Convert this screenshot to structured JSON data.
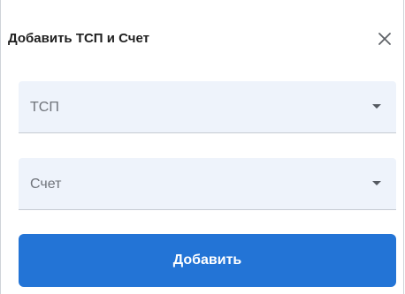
{
  "dialog": {
    "title": "Добавить ТСП и Счет",
    "close_icon": "close-icon"
  },
  "fields": {
    "tsp": {
      "label": "ТСП",
      "icon": "dropdown-arrow-icon"
    },
    "account": {
      "label": "Счет",
      "icon": "dropdown-arrow-icon"
    }
  },
  "actions": {
    "add_label": "Добавить"
  },
  "colors": {
    "primary": "#2374d6",
    "field_background": "#eef3fb",
    "title_text": "#1f1f1f",
    "field_label": "#6f737a",
    "field_border": "#c6cbd2"
  }
}
